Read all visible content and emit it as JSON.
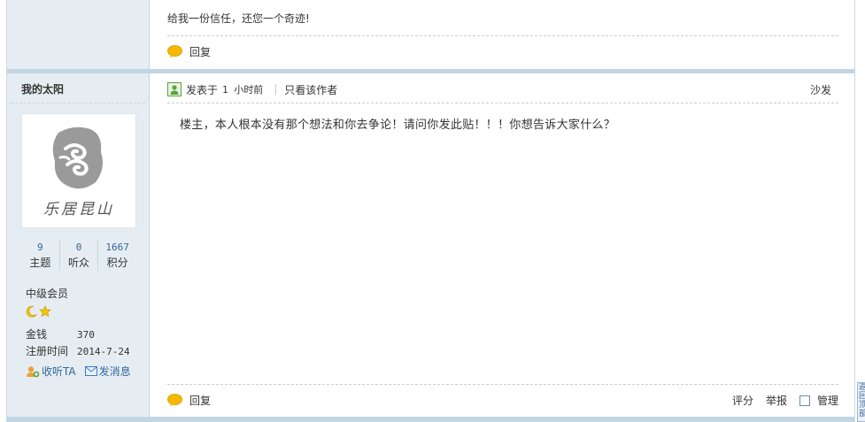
{
  "post1": {
    "message": "给我一份信任，还您一个奇迹!",
    "reply_label": "回复"
  },
  "post2": {
    "author": {
      "username": "我的太阳",
      "avatar_text": "乐居昆山",
      "stats": [
        {
          "value": "9",
          "label": "主题"
        },
        {
          "value": "0",
          "label": "听众"
        },
        {
          "value": "1667",
          "label": "积分"
        }
      ],
      "level": "中级会员",
      "money_label": "金钱",
      "money_value": "370",
      "reg_label": "注册时间",
      "reg_value": "2014-7-24",
      "follow_label": "收听TA",
      "message_label": "发消息"
    },
    "header": {
      "posted_label": "发表于",
      "posted_time": "1 小时前",
      "only_author": "只看该作者",
      "floor": "沙发"
    },
    "body": "楼主，本人根本没有那个想法和你去争论！请问你发此贴！！！你想告诉大家什么？",
    "footer": {
      "reply_label": "回复",
      "rate_label": "评分",
      "report_label": "举报",
      "manage_label": "管理"
    }
  },
  "back_to_top": "返回顶部",
  "colors": {
    "sidebar_bg": "#e5edf2",
    "border": "#c2d5e3",
    "link": "#336699",
    "reply_icon": "#f5b800"
  }
}
